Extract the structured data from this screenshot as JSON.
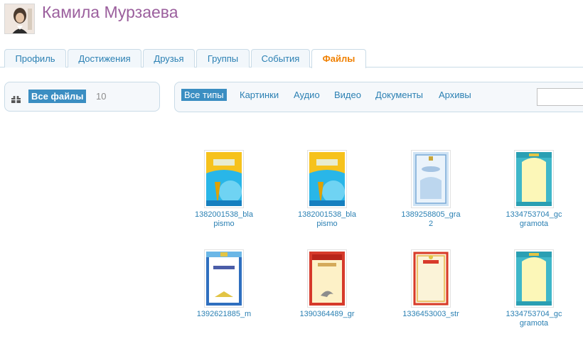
{
  "profile": {
    "name": "Камила Мурзаева"
  },
  "tabs": [
    {
      "label": "Профиль"
    },
    {
      "label": "Достижения"
    },
    {
      "label": "Друзья"
    },
    {
      "label": "Группы"
    },
    {
      "label": "События"
    },
    {
      "label": "Файлы",
      "active": true
    }
  ],
  "sidebar": {
    "all_files_label": "Все файлы",
    "count": "10",
    "icon": "gift-icon"
  },
  "filters": [
    {
      "label": "Все типы",
      "active": true
    },
    {
      "label": "Картинки"
    },
    {
      "label": "Аудио"
    },
    {
      "label": "Видео"
    },
    {
      "label": "Документы"
    },
    {
      "label": "Архивы"
    }
  ],
  "search": {
    "placeholder": ""
  },
  "files": [
    {
      "line1": "1382001538_bla",
      "line2": "pismo",
      "style": "blue-flag"
    },
    {
      "line1": "1382001538_bla",
      "line2": "pismo",
      "style": "blue-flag"
    },
    {
      "line1": "1389258805_gra",
      "line2": "2",
      "style": "blue-ornament"
    },
    {
      "line1": "1334753704_gc",
      "line2": "gramota",
      "style": "teal-frame"
    },
    {
      "line1": "1392621885_m",
      "line2": "",
      "style": "white-blue"
    },
    {
      "line1": "1390364489_gr",
      "line2": "",
      "style": "red-gold"
    },
    {
      "line1": "1336453003_str",
      "line2": "",
      "style": "cream-red"
    },
    {
      "line1": "1334753704_gc",
      "line2": "gramota",
      "style": "teal-frame"
    }
  ]
}
